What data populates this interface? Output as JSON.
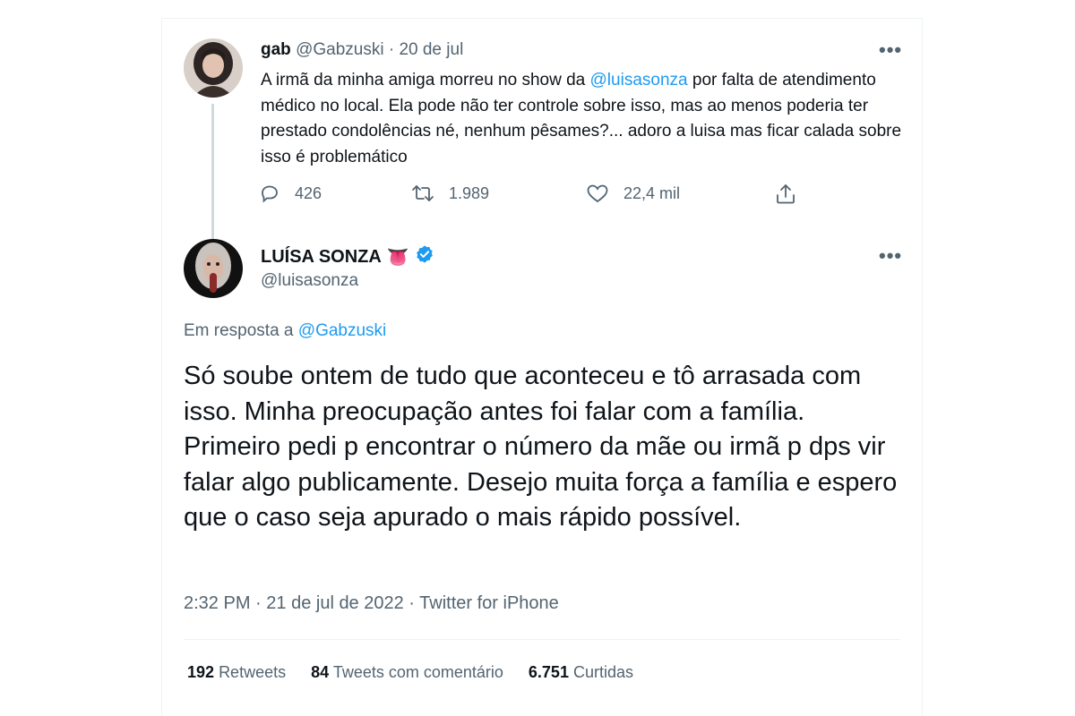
{
  "parent_tweet": {
    "name": "gab",
    "handle": "@Gabzuski",
    "separator": "·",
    "date": "20 de jul",
    "more_label": "•••",
    "text_before": "A irmã da minha amiga morreu no show da ",
    "mention": "@luisasonza",
    "text_after": " por falta de atendimento médico no local. Ela pode não ter controle sobre isso, mas ao menos poderia ter prestado condolências né, nenhum pêsames?... adoro a luisa mas ficar calada sobre isso é problemático",
    "replies": "426",
    "retweets": "1.989",
    "likes": "22,4 mil",
    "icons": [
      "reply-icon",
      "retweet-icon",
      "like-icon",
      "share-icon"
    ]
  },
  "main_tweet": {
    "name": "LUÍSA SONZA",
    "emoji": "👅",
    "verified_icon": "verified-badge-icon",
    "handle": "@luisasonza",
    "more_label": "•••",
    "reply_prefix": "Em resposta a ",
    "reply_mention": "@Gabzuski",
    "text": "Só soube ontem de tudo que aconteceu e tô arrasada com isso. Minha preocupação antes foi falar com a família. Primeiro pedi p encontrar o número da mãe ou irmã p dps vir falar algo publicamente. Desejo muita força a família e espero que o caso seja apurado o mais rápido possível.",
    "time": "2:32 PM",
    "date": "21 de jul de 2022",
    "source": "Twitter for iPhone",
    "meta_separator": " · ",
    "stats": {
      "retweets_count": "192",
      "retweets_label": "Retweets",
      "quotes_count": "84",
      "quotes_label": "Tweets com comentário",
      "likes_count": "6.751",
      "likes_label": "Curtidas"
    }
  },
  "colors": {
    "text": "#0f1419",
    "secondary": "#536471",
    "accent": "#1d9bf0",
    "border": "#eff3f4"
  }
}
